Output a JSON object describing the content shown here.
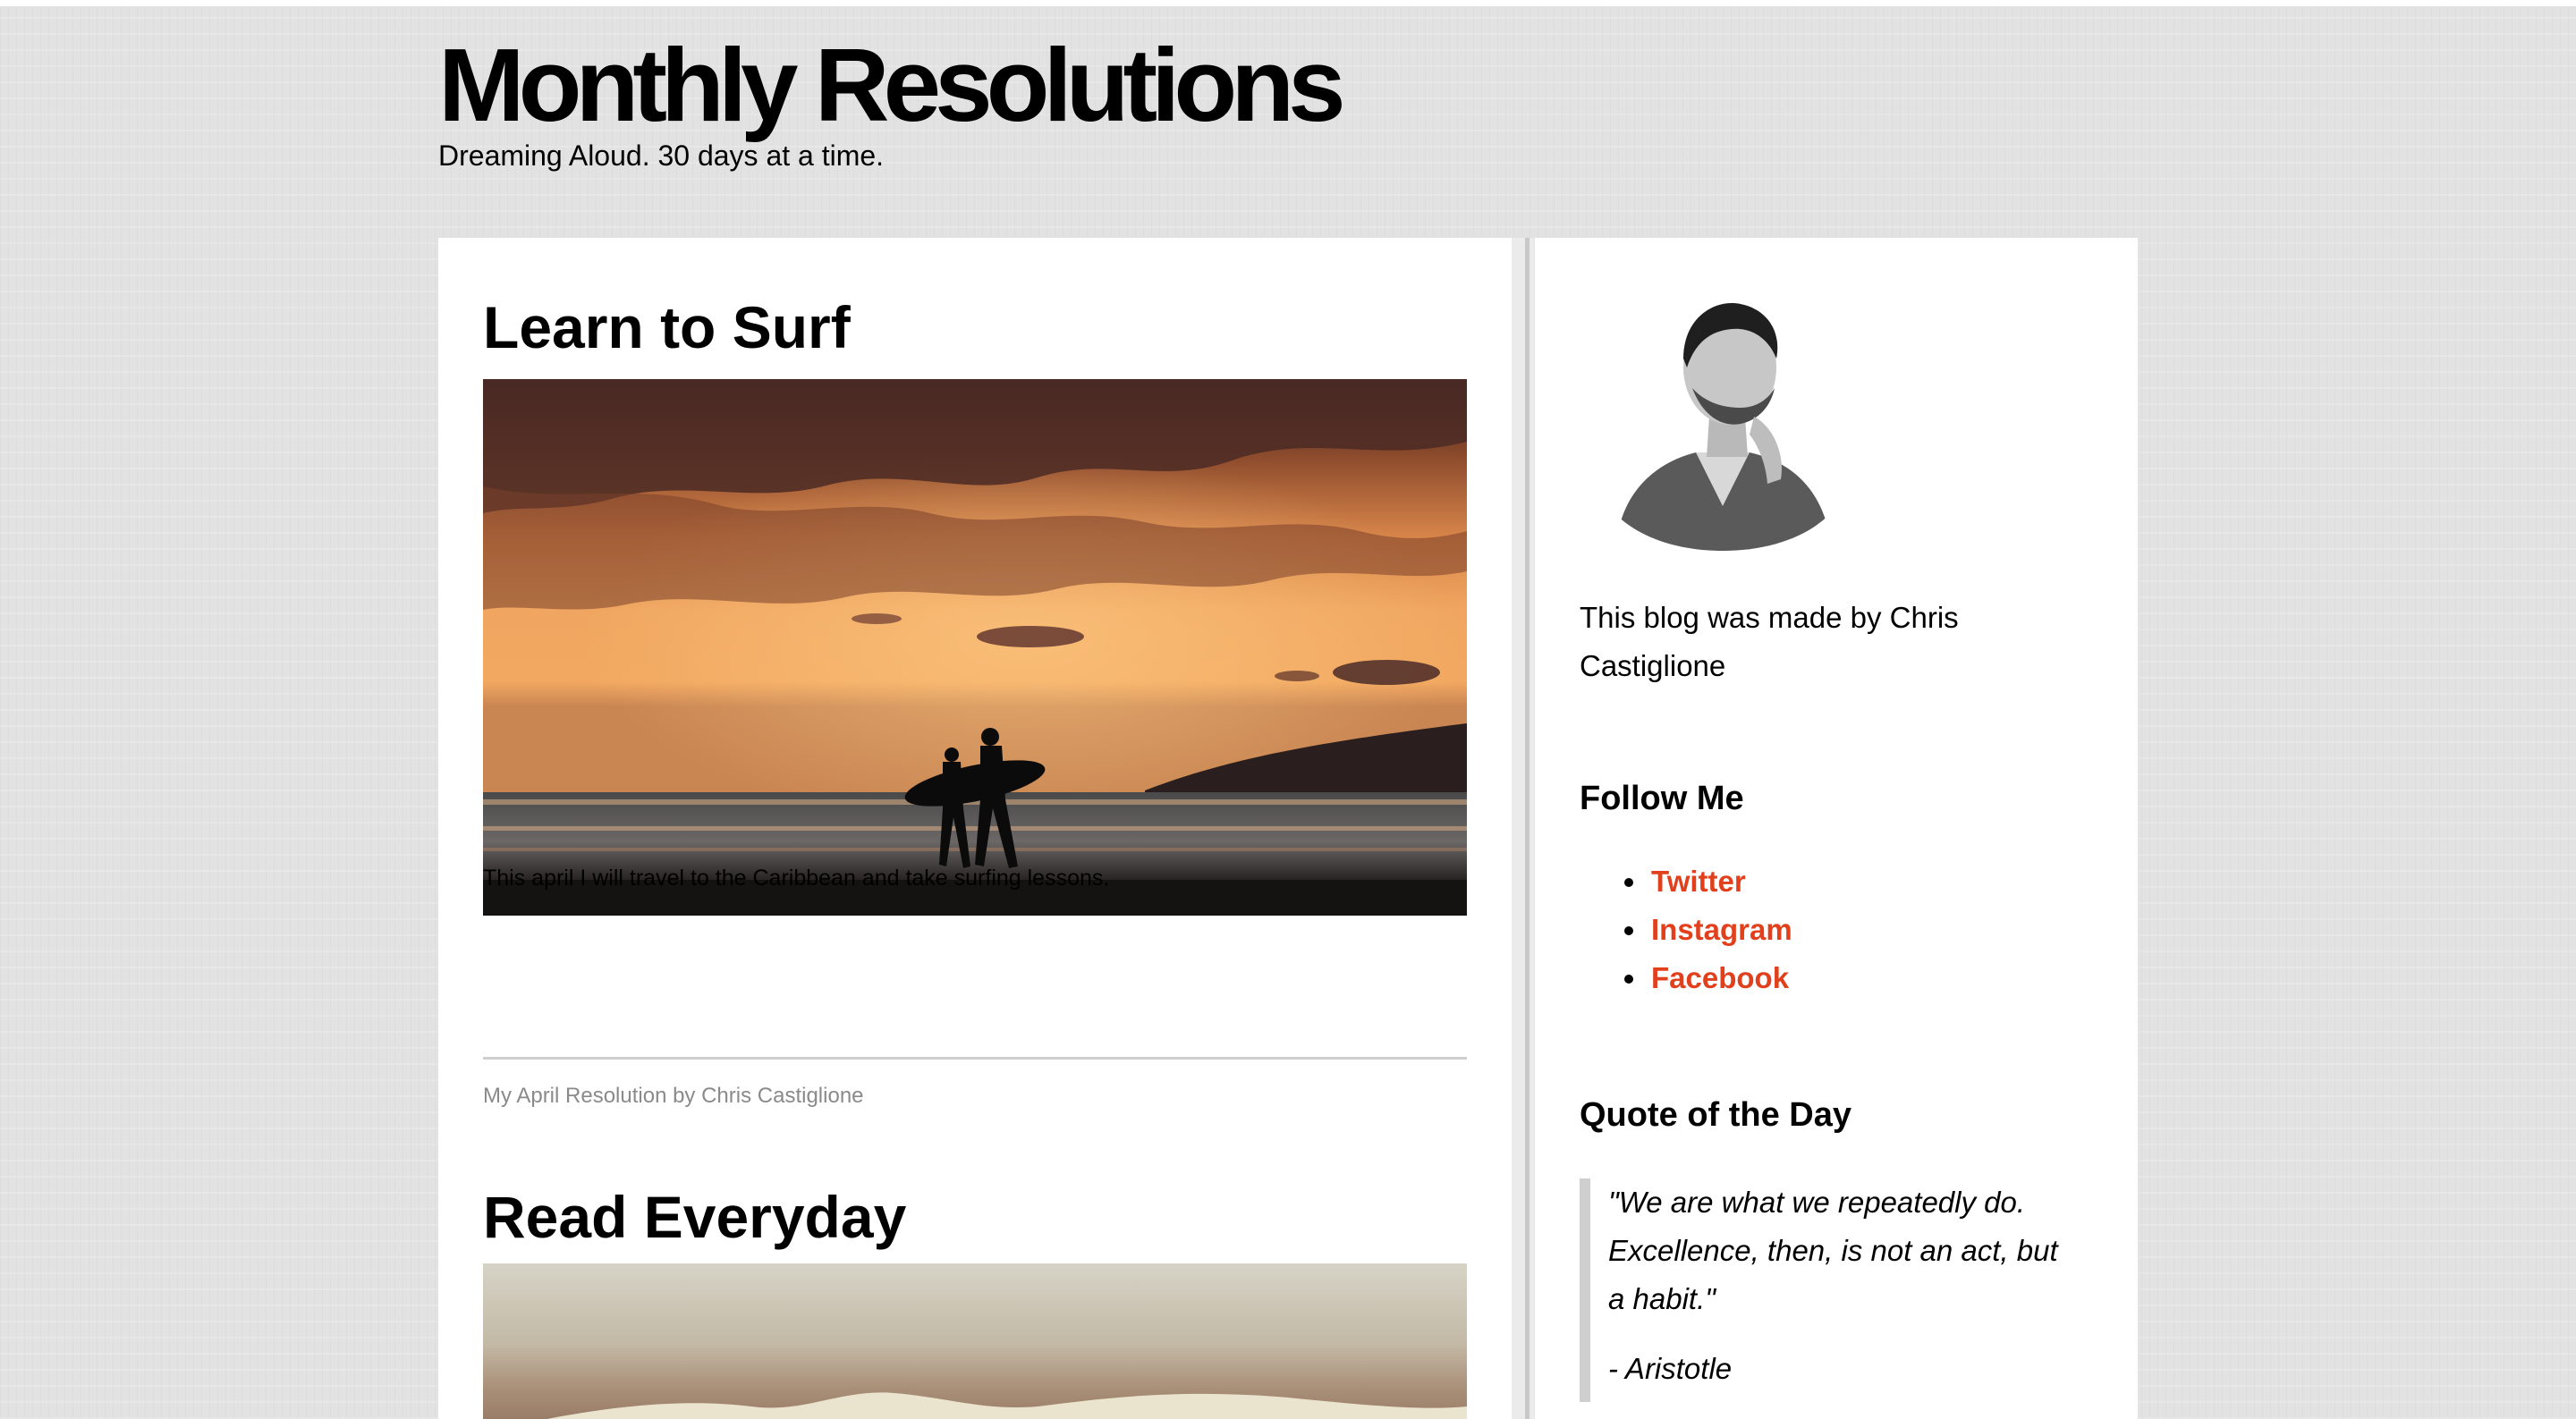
{
  "site": {
    "title": "Monthly Resolutions",
    "tagline": "Dreaming Aloud. 30 days at a time."
  },
  "posts": [
    {
      "title": "Learn to Surf",
      "image_desc": "sunset-surfers-photo",
      "body": "This april I will travel to the Caribbean and take surfing lessons.",
      "meta": "My April Resolution by Chris Castiglione"
    },
    {
      "title": "Read Everyday",
      "image_desc": "book-pages-photo"
    }
  ],
  "sidebar": {
    "about": "This blog was made by Chris Castiglione",
    "follow_heading": "Follow Me",
    "follow_links": [
      "Twitter",
      "Instagram",
      "Facebook"
    ],
    "quote_heading": "Quote of the Day",
    "quote_text": "\"We are what we repeatedly do. Excellence, then, is not an act, but a habit.\"",
    "quote_author": "- Aristotle"
  },
  "colors": {
    "link": "#e2401c",
    "background": "#e2e2e2",
    "panel": "#ffffff",
    "meta_text": "#8a8a8a"
  }
}
